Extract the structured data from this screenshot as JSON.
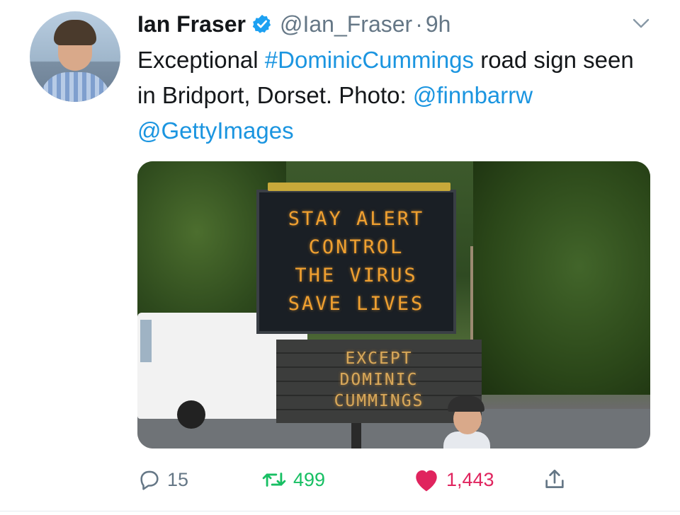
{
  "tweet": {
    "author": {
      "name": "Ian Fraser",
      "handle": "@Ian_Fraser",
      "separator": "·",
      "time": "9h",
      "verified_icon": "verified-badge-icon",
      "avatar_icon": "profile-photo"
    },
    "text": {
      "part1": "Exceptional ",
      "hashtag": "#DominicCummings",
      "part2": " road sign seen in Bridport, Dorset. Photo: ",
      "mention1": "@finnbarrw",
      "space": " ",
      "mention2": "@GettyImages"
    },
    "media": {
      "sign_top_lines": [
        "STAY ALERT",
        "CONTROL",
        "THE VIRUS",
        "SAVE LIVES"
      ],
      "sign_bottom_lines": [
        "EXCEPT",
        "DOMINIC",
        "CUMMINGS"
      ]
    },
    "actions": {
      "reply_count": "15",
      "retweet_count": "499",
      "like_count": "1,443"
    }
  },
  "colors": {
    "link": "#1b95e0",
    "muted": "#657786",
    "retweet_active": "#17bf63",
    "like_active": "#e0245e"
  }
}
